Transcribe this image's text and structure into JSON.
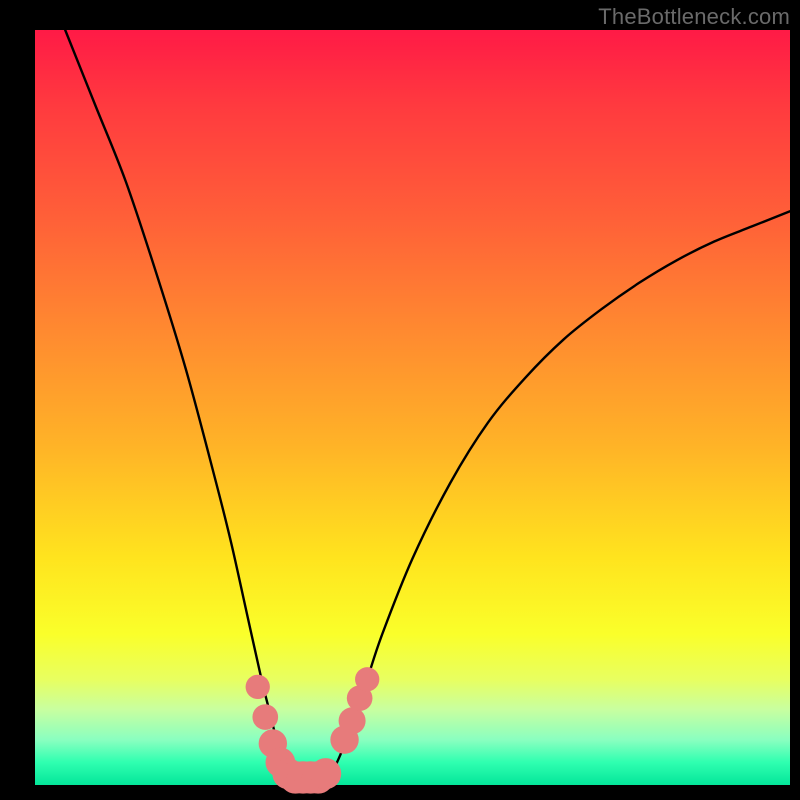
{
  "watermark": "TheBottleneck.com",
  "chart_data": {
    "type": "line",
    "title": "",
    "xlabel": "",
    "ylabel": "",
    "xlim": [
      0,
      100
    ],
    "ylim": [
      0,
      100
    ],
    "background_gradient": {
      "top": "#ff1a46",
      "middle": "#ffe41e",
      "bottom": "#04e69a"
    },
    "series": [
      {
        "name": "bottleneck-curve",
        "color": "#000000",
        "x": [
          4,
          8,
          12,
          16,
          20,
          24,
          26,
          28,
          30,
          31,
          32,
          33,
          34,
          35,
          36,
          37,
          38,
          39,
          40,
          42,
          44,
          46,
          50,
          55,
          60,
          65,
          70,
          75,
          80,
          85,
          90,
          95,
          100
        ],
        "y": [
          100,
          90,
          80,
          68,
          55,
          40,
          32,
          23,
          14,
          10,
          6,
          3,
          1.5,
          1,
          1,
          1,
          1,
          1.5,
          3,
          8,
          14,
          20,
          30,
          40,
          48,
          54,
          59,
          63,
          66.5,
          69.5,
          72,
          74,
          76
        ]
      },
      {
        "name": "marker-dots",
        "color": "#e77b7b",
        "type": "scatter",
        "points": [
          {
            "x": 29.5,
            "y": 13,
            "r": 1.2
          },
          {
            "x": 30.5,
            "y": 9,
            "r": 1.3
          },
          {
            "x": 31.5,
            "y": 5.5,
            "r": 1.5
          },
          {
            "x": 32.5,
            "y": 3,
            "r": 1.6
          },
          {
            "x": 33.5,
            "y": 1.5,
            "r": 1.7
          },
          {
            "x": 34.5,
            "y": 1,
            "r": 1.8
          },
          {
            "x": 35.5,
            "y": 1,
            "r": 1.8
          },
          {
            "x": 36.5,
            "y": 1,
            "r": 1.8
          },
          {
            "x": 37.5,
            "y": 1,
            "r": 1.8
          },
          {
            "x": 38.5,
            "y": 1.5,
            "r": 1.7
          },
          {
            "x": 41,
            "y": 6,
            "r": 1.5
          },
          {
            "x": 42,
            "y": 8.5,
            "r": 1.4
          },
          {
            "x": 43,
            "y": 11.5,
            "r": 1.3
          },
          {
            "x": 44,
            "y": 14,
            "r": 1.2
          }
        ]
      }
    ]
  }
}
